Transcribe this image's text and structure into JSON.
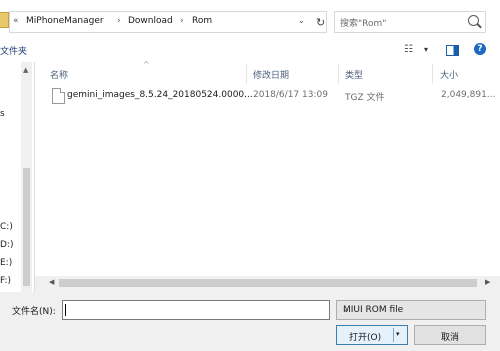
{
  "address_bar": {
    "overflow": "«",
    "crumbs": [
      "MiPhoneManager",
      "Download",
      "Rom"
    ],
    "separator": "›",
    "dropdown": "⌄",
    "refresh": "↻"
  },
  "search": {
    "placeholder": "搜索\"Rom\""
  },
  "toolbar": {
    "new_folder": "文件夹",
    "view_icon": "☷",
    "view_caret": "▾",
    "help": "?"
  },
  "nav_pane": {
    "items": [
      "s",
      "C:)",
      "D:)",
      "E:)",
      "F:)"
    ]
  },
  "file_list": {
    "columns": {
      "name": "名称",
      "modified": "修改日期",
      "type": "类型",
      "size": "大小"
    },
    "sort_indicator": "^",
    "rows": [
      {
        "name": "gemini_images_8.5.24_20180524.0000...",
        "modified": "2018/6/17 13:09",
        "type": "TGZ 文件",
        "size": "2,049,891..."
      }
    ]
  },
  "bottom_bar": {
    "filename_label": "文件名(N):",
    "filename_value": "",
    "filetype": "MIUI ROM file",
    "filetype_caret": "⌄",
    "open_label": "打开(O)",
    "open_caret": "▾",
    "cancel_label": "取消"
  }
}
